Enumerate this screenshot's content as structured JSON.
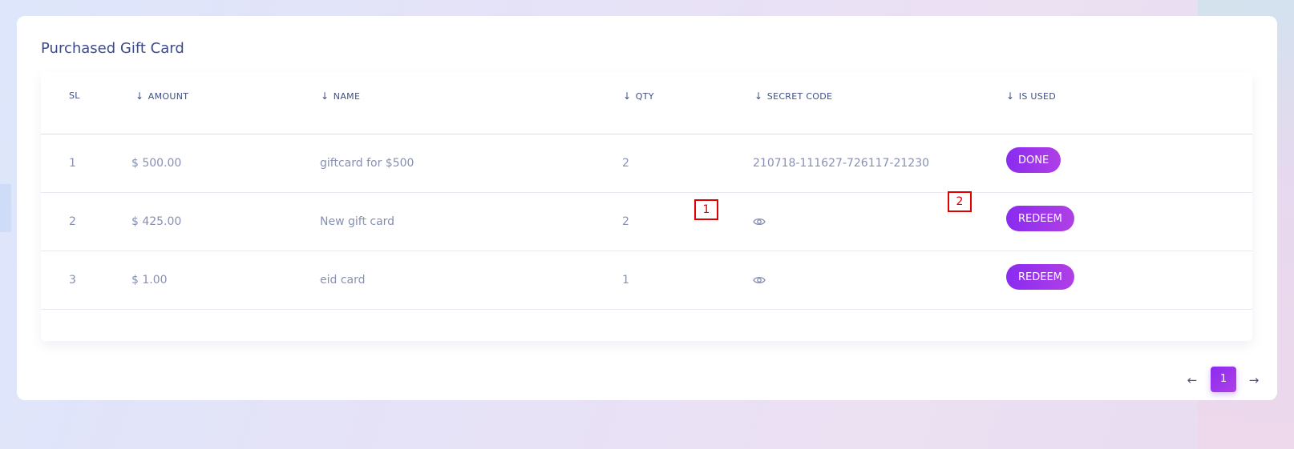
{
  "page": {
    "title": "Purchased Gift Card"
  },
  "table": {
    "headers": {
      "sl": "SL",
      "amount": "AMOUNT",
      "name": "NAME",
      "qty": "QTY",
      "secret_code": "SECRET CODE",
      "is_used": "IS USED"
    },
    "rows": [
      {
        "sl": "1",
        "amount": "$ 500.00",
        "name": "giftcard for $500",
        "qty": "2",
        "secret_code": "210718-111627-726117-21230",
        "secret_hidden": false,
        "status": "DONE"
      },
      {
        "sl": "2",
        "amount": "$ 425.00",
        "name": "New gift card",
        "qty": "2",
        "secret_code": "",
        "secret_hidden": true,
        "status": "REDEEM"
      },
      {
        "sl": "3",
        "amount": "$ 1.00",
        "name": "eid card",
        "qty": "1",
        "secret_code": "",
        "secret_hidden": true,
        "status": "REDEEM"
      }
    ]
  },
  "annotations": {
    "marker_1": "1",
    "marker_2": "2"
  },
  "pagination": {
    "current_page": "1",
    "prev_icon": "arrow-left-icon",
    "next_icon": "arrow-right-icon"
  },
  "theme": {
    "accent": "#8a2bf0",
    "accent_end": "#b040e6",
    "title_color": "#3b4a8c",
    "text_muted": "#8790b3",
    "marker_color": "#e00000"
  }
}
